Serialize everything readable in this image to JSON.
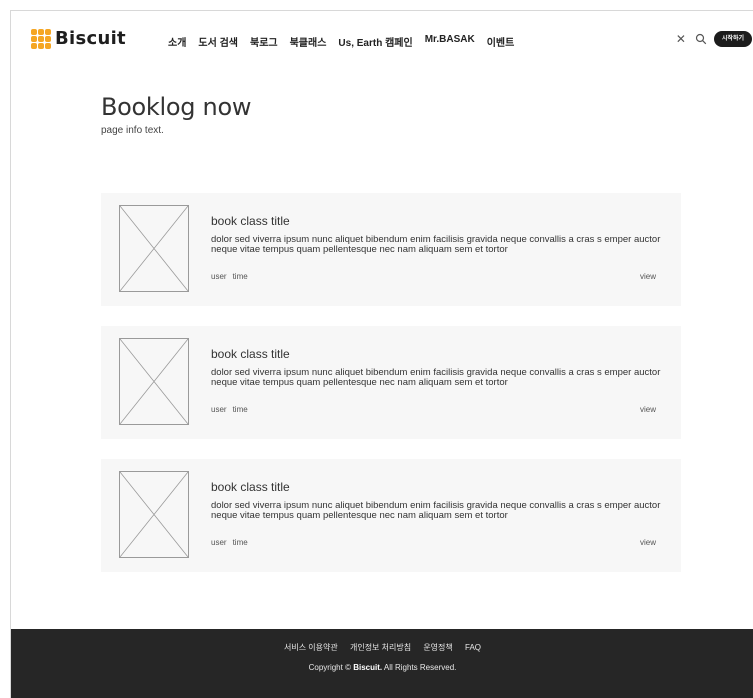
{
  "header": {
    "logo_text": "Biscuit",
    "nav": [
      "소개",
      "도서 검색",
      "북로그",
      "북클래스",
      "Us, Earth 캠페인",
      "Mr.BASAK",
      "이벤트"
    ],
    "close_glyph": "✕",
    "start_label": "시작하기"
  },
  "page": {
    "title": "Booklog now",
    "info": "page info text."
  },
  "cards": [
    {
      "title": "book class title",
      "description": "dolor sed viverra ipsum nunc aliquet bibendum enim facilisis gravida neque convallis a cras s emper auctor neque vitae tempus quam pellentesque nec nam aliquam sem et tortor",
      "user": "user",
      "time": "time",
      "view": "view"
    },
    {
      "title": "book class title",
      "description": "dolor sed viverra ipsum nunc aliquet bibendum enim facilisis gravida neque convallis a cras s emper auctor neque vitae tempus quam pellentesque nec nam aliquam sem et tortor",
      "user": "user",
      "time": "time",
      "view": "view"
    },
    {
      "title": "book class title",
      "description": "dolor sed viverra ipsum nunc aliquet bibendum enim facilisis gravida neque convallis a cras s emper auctor neque vitae tempus quam pellentesque nec nam aliquam sem et tortor",
      "user": "user",
      "time": "time",
      "view": "view"
    }
  ],
  "footer": {
    "links": [
      "서비스 이용약관",
      "개인정보 처리방침",
      "운영정책",
      "FAQ"
    ],
    "copyright_prefix": "Copyright ©",
    "copyright_brand": "Biscuit.",
    "copyright_suffix": "All Rights Reserved."
  },
  "colors": {
    "brand": "#f5a623",
    "card_bg": "#f7f7f7",
    "footer_bg": "#262626"
  }
}
